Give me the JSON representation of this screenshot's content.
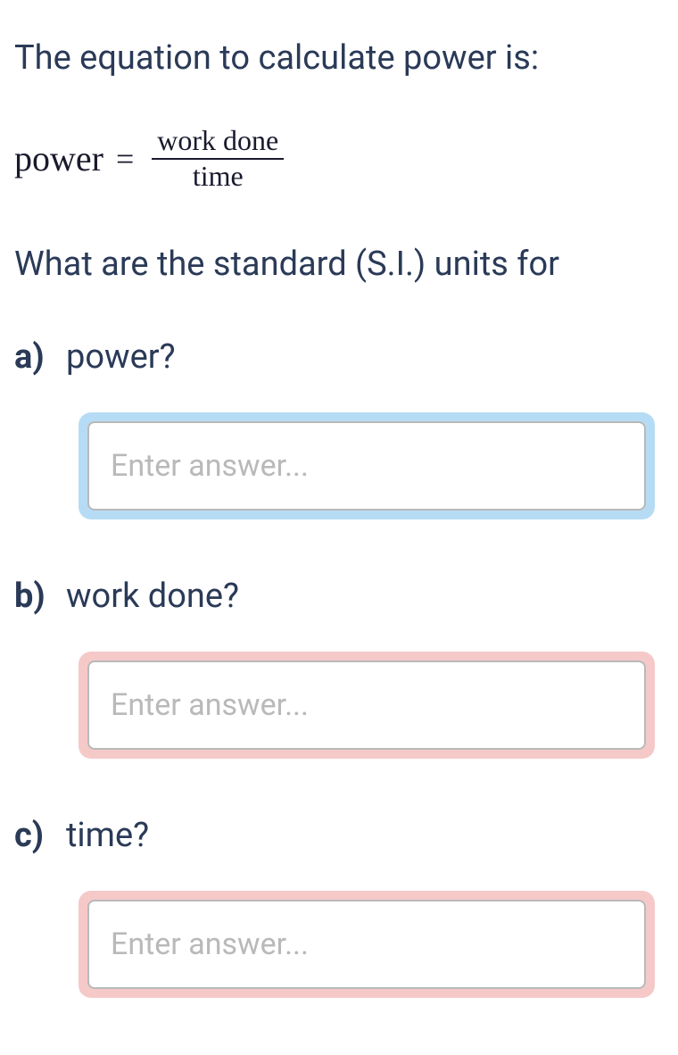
{
  "intro": "The equation to calculate power is:",
  "equation": {
    "lhs": "power",
    "equals": "=",
    "numerator": "work done",
    "denominator": "time"
  },
  "question_prompt": "What are the standard (S.I.) units for",
  "parts": {
    "a": {
      "label": "a)",
      "text": "power?",
      "placeholder": "Enter answer..."
    },
    "b": {
      "label": "b)",
      "text": "work done?",
      "placeholder": "Enter answer..."
    },
    "c": {
      "label": "c)",
      "text": "time?",
      "placeholder": "Enter answer..."
    }
  }
}
